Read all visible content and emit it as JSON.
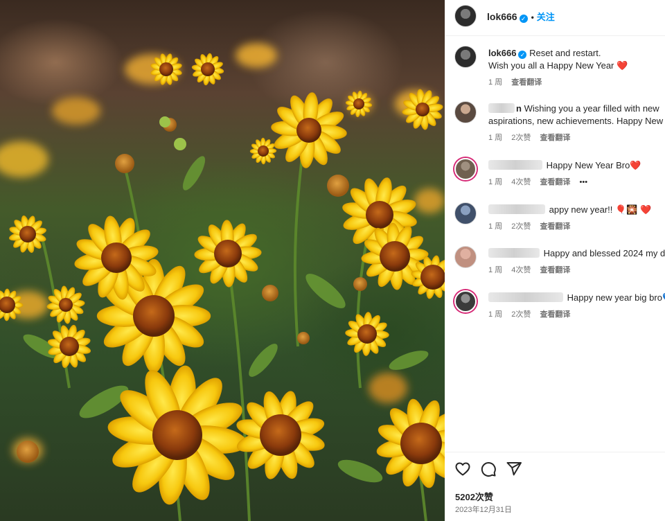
{
  "post": {
    "author": "lok666",
    "follow_label": "关注",
    "dot": "•",
    "caption_line1": "Reset and restart.",
    "caption_line2": "Wish you all a Happy New Year",
    "caption_emoji": "❤️",
    "caption_time": "1 周",
    "translate_label": "查看翻译",
    "likes": "5202次赞",
    "date": "2023年12月31日"
  },
  "comments": [
    {
      "name_visible": "n",
      "text_line1": "Wishing you a year filled with new",
      "text_line2": "aspirations, new achievements. Happy New",
      "time": "1 周",
      "likes": "2次赞",
      "translate": "查看翻译",
      "more": ""
    },
    {
      "name_visible": "",
      "text_line1": "Happy New Year Bro",
      "emoji": "❤️",
      "time": "1 周",
      "likes": "4次赞",
      "translate": "查看翻译",
      "more": "•••"
    },
    {
      "name_visible": "",
      "text_line1": "appy new year!! ",
      "emoji": "🎈🎇 ❤️",
      "time": "1 周",
      "likes": "2次赞",
      "translate": "查看翻译",
      "more": ""
    },
    {
      "name_visible": "",
      "text_line1": "Happy and blessed 2024 my de",
      "time": "1 周",
      "likes": "4次赞",
      "translate": "查看翻译",
      "more": ""
    },
    {
      "name_visible": "",
      "text_line1": "Happy new year big bro",
      "emoji": "💙",
      "time": "1 周",
      "likes": "2次赞",
      "translate": "查看翻译",
      "more": ""
    }
  ],
  "icons": {
    "like": "heart-icon",
    "comment": "comment-icon",
    "share": "paper-plane-icon",
    "verified": "verified-badge-icon"
  },
  "colors": {
    "accent": "#0095f6",
    "text": "#262626",
    "muted": "#737373",
    "story_ring": "#d62976"
  }
}
